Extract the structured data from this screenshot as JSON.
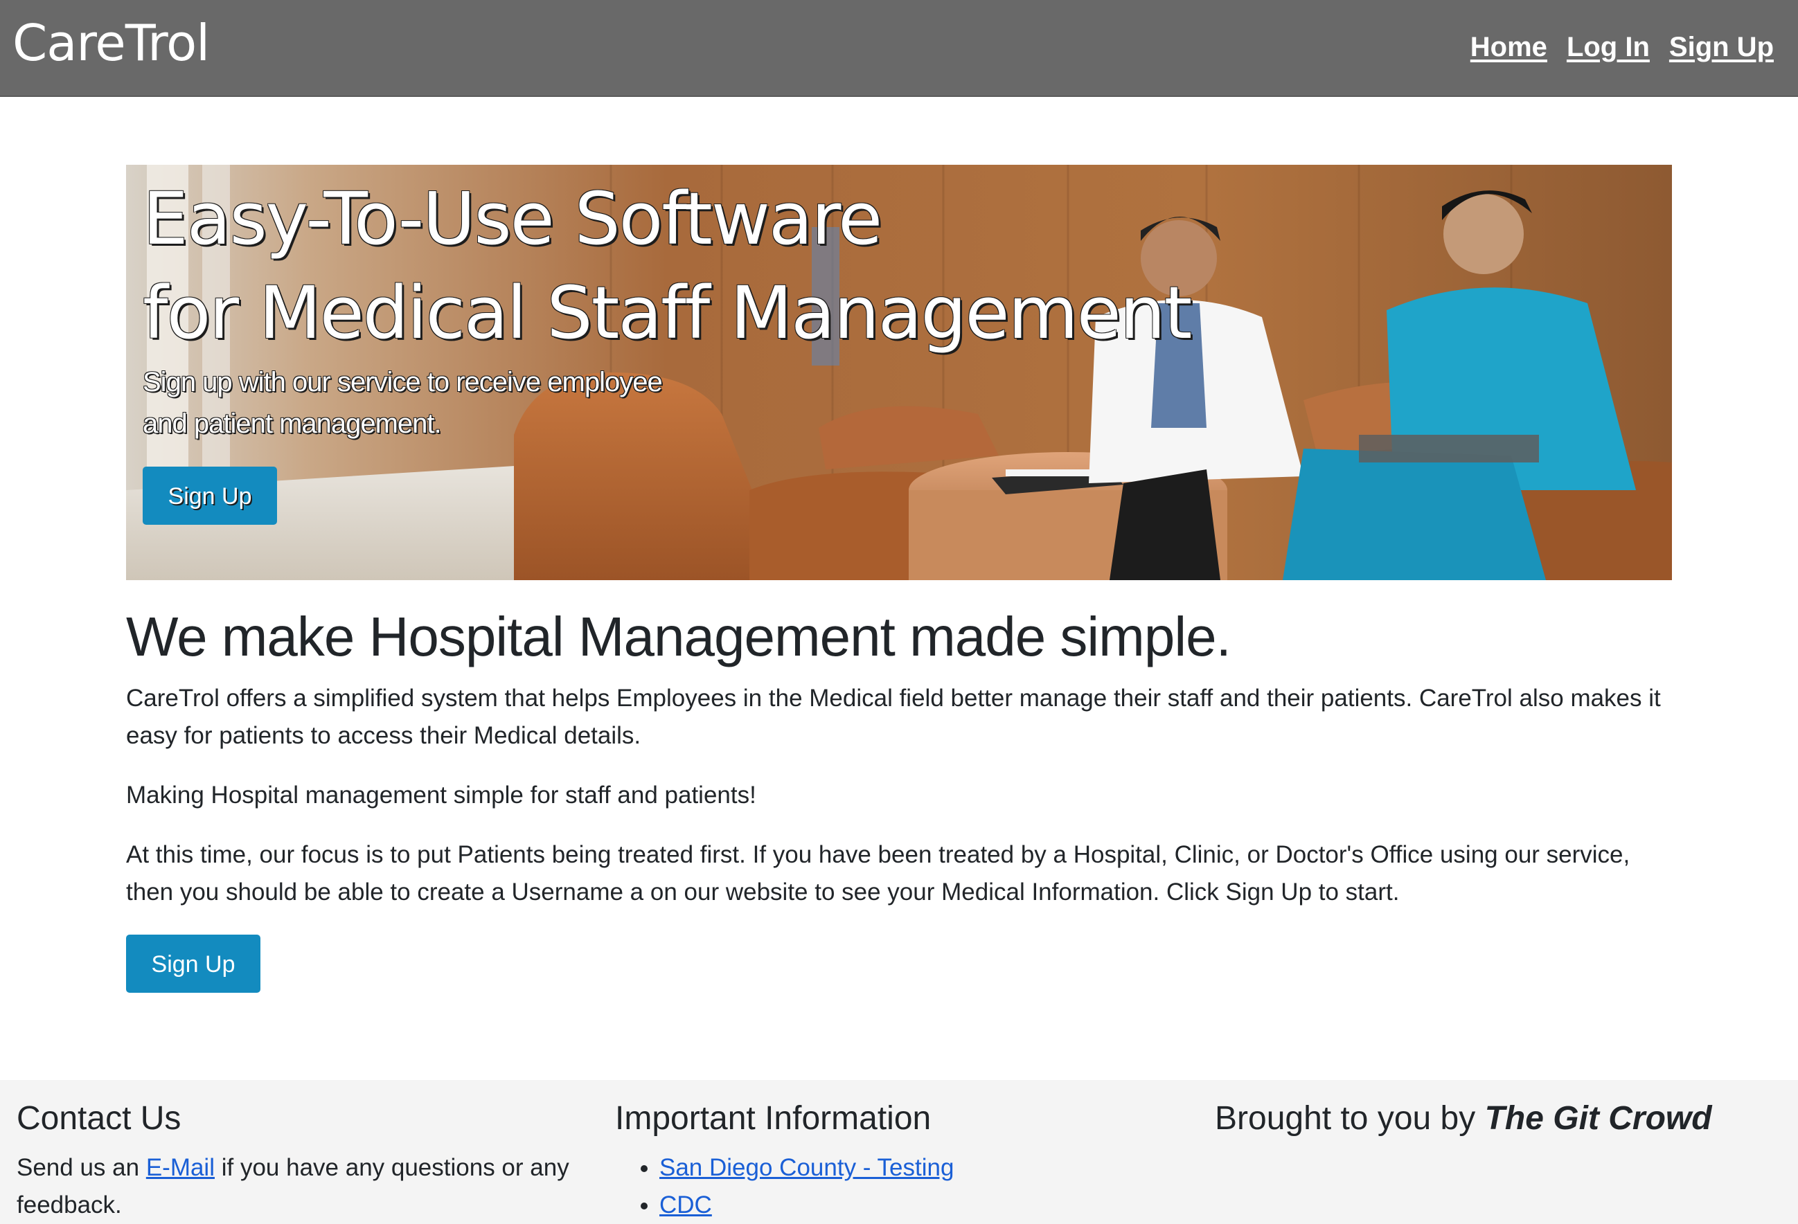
{
  "navbar": {
    "brand": "CareTrol",
    "links": [
      "Home",
      "Log In",
      "Sign Up"
    ]
  },
  "hero": {
    "title_line1": "Easy-To-Use Software",
    "title_line2": "for Medical Staff Management",
    "subtitle": "Sign up with our service to receive employee and patient management.",
    "button_label": "Sign Up"
  },
  "main": {
    "heading": "We make Hospital Management made simple.",
    "paragraph1": "CareTrol offers a simplified system that helps Employees in the Medical field better manage their staff and their patients. CareTrol also makes it easy for patients to access their Medical details.",
    "paragraph2": "Making Hospital management simple for staff and patients!",
    "paragraph3": "At this time, our focus is to put Patients being treated first. If you have been treated by a Hospital, Clinic, or Doctor's Office using our service, then you should be able to create a Username a on our website to see your Medical Information. Click Sign Up to start.",
    "button_label": "Sign Up"
  },
  "footer": {
    "contact": {
      "heading": "Contact Us",
      "text_before": "Send us an ",
      "link": "E-Mail",
      "text_after": " if you have any questions or any feedback."
    },
    "info": {
      "heading": "Important Information",
      "links": [
        "San Diego County - Testing",
        "CDC"
      ]
    },
    "credit": {
      "heading_prefix": "Brought to you by ",
      "heading_emphasis": "The Git Crowd"
    }
  },
  "colors": {
    "navbar": "#696969",
    "button": "#138bbf",
    "link": "#1a5fd6",
    "footer_bg": "#f4f4f4"
  }
}
